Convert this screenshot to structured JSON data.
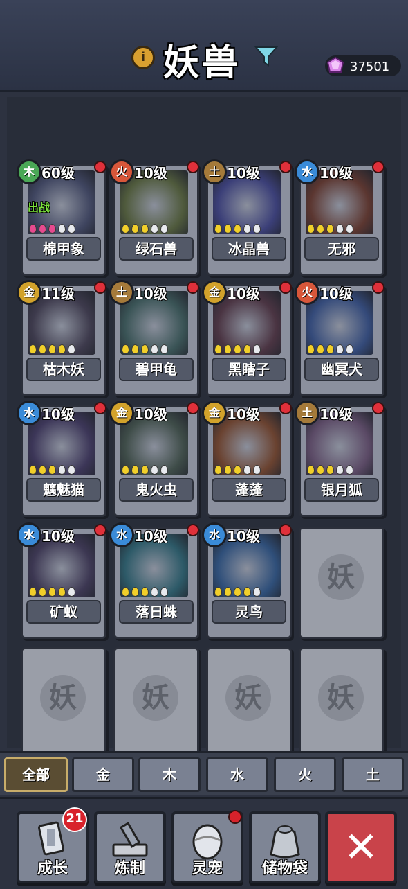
{
  "header": {
    "title": "妖兽",
    "gems": "37501"
  },
  "beasts": [
    {
      "element": "木",
      "element_color": "#4aa856",
      "level": "60级",
      "name": "棉甲象",
      "stars": 5,
      "filled": 3,
      "drop_color": "pink",
      "deployed": "出战",
      "bg": "#3f4560"
    },
    {
      "element": "火",
      "element_color": "#d8573a",
      "level": "10级",
      "name": "绿石兽",
      "stars": 5,
      "filled": 3,
      "drop_color": "gold",
      "bg": "#4f5a3c"
    },
    {
      "element": "土",
      "element_color": "#a57a3a",
      "level": "10级",
      "name": "冰晶兽",
      "stars": 5,
      "filled": 3,
      "drop_color": "gold",
      "bg": "#3b3f78"
    },
    {
      "element": "水",
      "element_color": "#3a8bd8",
      "level": "10级",
      "name": "无邪",
      "stars": 5,
      "filled": 3,
      "drop_color": "gold",
      "bg": "#5b3630"
    },
    {
      "element": "金",
      "element_color": "#d2a22b",
      "level": "11级",
      "name": "枯木妖",
      "stars": 5,
      "filled": 4,
      "drop_color": "gold",
      "bg": "#3d3a4c"
    },
    {
      "element": "土",
      "element_color": "#a57a3a",
      "level": "10级",
      "name": "碧甲龟",
      "stars": 5,
      "filled": 3,
      "drop_color": "gold",
      "bg": "#3a5456"
    },
    {
      "element": "金",
      "element_color": "#d2a22b",
      "level": "10级",
      "name": "黑瞎子",
      "stars": 5,
      "filled": 4,
      "drop_color": "gold",
      "bg": "#4a3442"
    },
    {
      "element": "火",
      "element_color": "#d8573a",
      "level": "10级",
      "name": "幽冥犬",
      "stars": 5,
      "filled": 3,
      "drop_color": "gold",
      "bg": "#344a7a"
    },
    {
      "element": "水",
      "element_color": "#3a8bd8",
      "level": "10级",
      "name": "魑魅猫",
      "stars": 5,
      "filled": 3,
      "drop_color": "gold",
      "bg": "#3c3658"
    },
    {
      "element": "金",
      "element_color": "#d2a22b",
      "level": "10级",
      "name": "鬼火虫",
      "stars": 5,
      "filled": 3,
      "drop_color": "gold",
      "bg": "#3e4c48"
    },
    {
      "element": "金",
      "element_color": "#d2a22b",
      "level": "10级",
      "name": "蓬蓬",
      "stars": 5,
      "filled": 3,
      "drop_color": "gold",
      "bg": "#6a4230"
    },
    {
      "element": "土",
      "element_color": "#a57a3a",
      "level": "10级",
      "name": "银月狐",
      "stars": 5,
      "filled": 3,
      "drop_color": "gold",
      "bg": "#5b4a66"
    },
    {
      "element": "水",
      "element_color": "#3a8bd8",
      "level": "10级",
      "name": "矿蚁",
      "stars": 5,
      "filled": 4,
      "drop_color": "gold",
      "bg": "#3c3752"
    },
    {
      "element": "水",
      "element_color": "#3a8bd8",
      "level": "10级",
      "name": "落日蛛",
      "stars": 5,
      "filled": 3,
      "drop_color": "gold",
      "bg": "#2d5a68"
    },
    {
      "element": "水",
      "element_color": "#3a8bd8",
      "level": "10级",
      "name": "灵鸟",
      "stars": 5,
      "filled": 4,
      "drop_color": "gold",
      "bg": "#2f4f7a"
    }
  ],
  "empty_slot_label": "妖",
  "empty_slots": 5,
  "tabs": [
    "全部",
    "金",
    "木",
    "水",
    "火",
    "土"
  ],
  "active_tab": 0,
  "bottom_buttons": [
    {
      "label": "成长",
      "badge": "21",
      "icon": "growth-icon"
    },
    {
      "label": "炼制",
      "icon": "forge-icon"
    },
    {
      "label": "灵宠",
      "icon": "pet-egg-icon",
      "dot": true
    },
    {
      "label": "储物袋",
      "icon": "storage-bag-icon"
    }
  ],
  "close_label": "✕"
}
